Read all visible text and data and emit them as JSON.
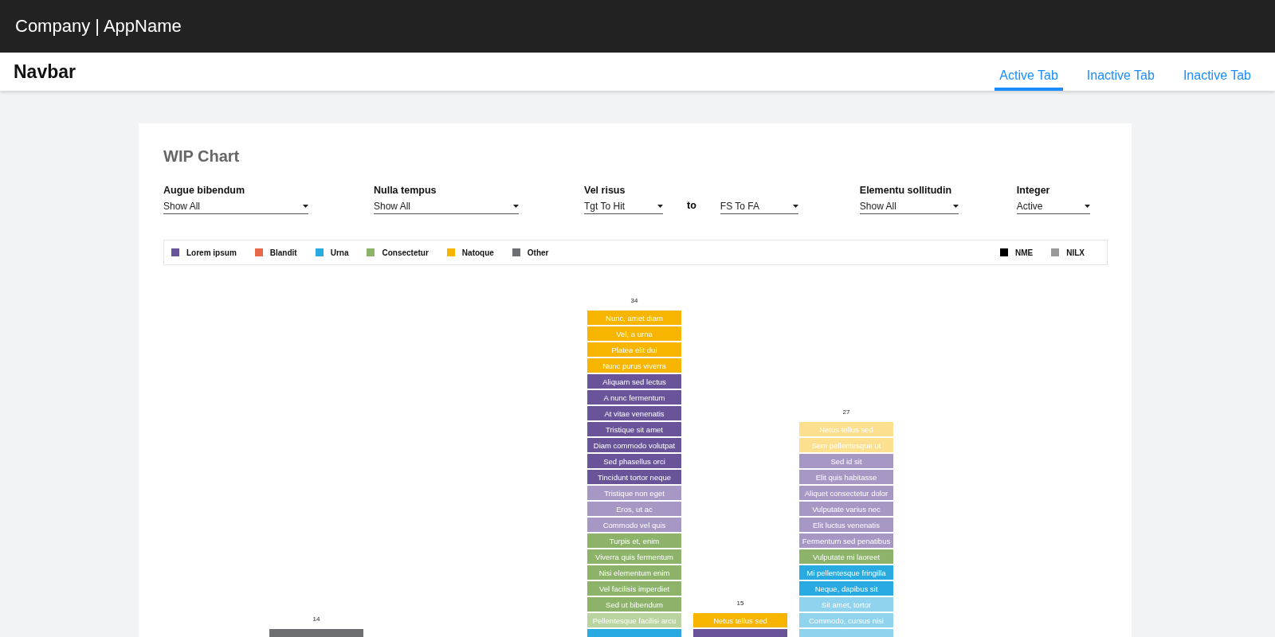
{
  "header": {
    "title": "Company | AppName"
  },
  "navbar": {
    "title": "Navbar",
    "tabs": [
      {
        "label": "Active Tab",
        "selected": true
      },
      {
        "label": "Inactive Tab",
        "selected": false
      },
      {
        "label": "Inactive Tab",
        "selected": false
      }
    ]
  },
  "card": {
    "title": "WIP Chart",
    "filters": [
      {
        "kind": "select",
        "label": "Augue bibendum",
        "value": "Show All"
      },
      {
        "kind": "select",
        "label": "Nulla tempus",
        "value": "Show All"
      },
      {
        "kind": "range",
        "label": "Vel risus",
        "value": "Tgt To Hit",
        "joiner": "to",
        "value_2": "FS To FA"
      },
      {
        "kind": "select",
        "label": "Elementu sollitudin",
        "value": "Show All"
      },
      {
        "kind": "select",
        "label": "Integer",
        "value": "Active"
      }
    ],
    "legend": [
      {
        "label": "Lorem ipsum",
        "color": "#6a5499"
      },
      {
        "label": "Blandit",
        "color": "#e8694a"
      },
      {
        "label": "Urna",
        "color": "#29abe2"
      },
      {
        "label": "Consectetur",
        "color": "#8db36b"
      },
      {
        "label": "Natoque",
        "color": "#f7b500"
      },
      {
        "label": "Other",
        "color": "#6d6e71"
      }
    ],
    "legend_right": [
      {
        "label": "NME",
        "color": "#000000"
      },
      {
        "label": "NILX",
        "color": "#999999"
      }
    ],
    "columns": [
      {
        "total": "14",
        "items": [
          {
            "color": "#6d6e71"
          }
        ]
      },
      {
        "total": "34",
        "items": [
          {
            "label": "Nunc, amet diam",
            "color": "#f7b500"
          },
          {
            "label": "Vel, a urna",
            "color": "#f7b500"
          },
          {
            "label": "Platea elit dui",
            "color": "#f7b500"
          },
          {
            "label": "Nunc purus viverra",
            "color": "#f7b500"
          },
          {
            "label": "Aliquam sed lectus",
            "color": "#6a5499"
          },
          {
            "label": "A nunc fermentum",
            "color": "#6a5499"
          },
          {
            "label": "At vitae venenatis",
            "color": "#6a5499"
          },
          {
            "label": "Tristique sit amet",
            "color": "#6a5499"
          },
          {
            "label": "Diam commodo volutpat",
            "color": "#6a5499"
          },
          {
            "label": "Sed phasellus orci",
            "color": "#6a5499"
          },
          {
            "label": "Tincidunt tortor neque",
            "color": "#6a5499"
          },
          {
            "label": "Tristique non eget",
            "color": "#a697c5"
          },
          {
            "label": "Eros, ut ac",
            "color": "#a697c5"
          },
          {
            "label": "Commodo vel quis",
            "color": "#a697c5"
          },
          {
            "label": "Turpis et, enim",
            "color": "#8db36b"
          },
          {
            "label": "Viverra quis fermentum",
            "color": "#8db36b"
          },
          {
            "label": "Nisi elementum enim",
            "color": "#8db36b"
          },
          {
            "label": "Vel facilisis imperdiet",
            "color": "#8db36b"
          },
          {
            "label": "Sed ut bibendum",
            "color": "#8db36b"
          },
          {
            "label": "Pellentesque facilisi arcu",
            "color": "#b9d4a1"
          },
          {
            "color": "#29abe2"
          }
        ]
      },
      {
        "total": "15",
        "items": [
          {
            "label": "Netus tellus sed",
            "color": "#f7b500"
          },
          {
            "color": "#6a5499"
          }
        ]
      },
      {
        "total": "27",
        "items": [
          {
            "label": "Netus tellus sed",
            "color": "#fde08f"
          },
          {
            "label": "Sem pellentesque ut",
            "color": "#fde08f"
          },
          {
            "label": "Sed id sit",
            "color": "#a697c5"
          },
          {
            "label": "Elit quis habitasse",
            "color": "#a697c5"
          },
          {
            "label": "Aliquet consectetur dolor",
            "color": "#a697c5"
          },
          {
            "label": "Vulputate varius nec",
            "color": "#a697c5"
          },
          {
            "label": "Elit luctus venenatis",
            "color": "#a697c5"
          },
          {
            "label": "Fermentum sed penatibus",
            "color": "#a697c5"
          },
          {
            "label": "Vulputate mi laoreet",
            "color": "#8db36b"
          },
          {
            "label": "Mi pellentesque fringilla",
            "color": "#29abe2"
          },
          {
            "label": "Neque, dapibus sit",
            "color": "#29abe2"
          },
          {
            "label": "Sit amet, tortor",
            "color": "#8fd3ef"
          },
          {
            "label": "Commodo, cursus nisi",
            "color": "#8fd3ef"
          },
          {
            "color": "#8fd3ef"
          }
        ]
      }
    ]
  }
}
